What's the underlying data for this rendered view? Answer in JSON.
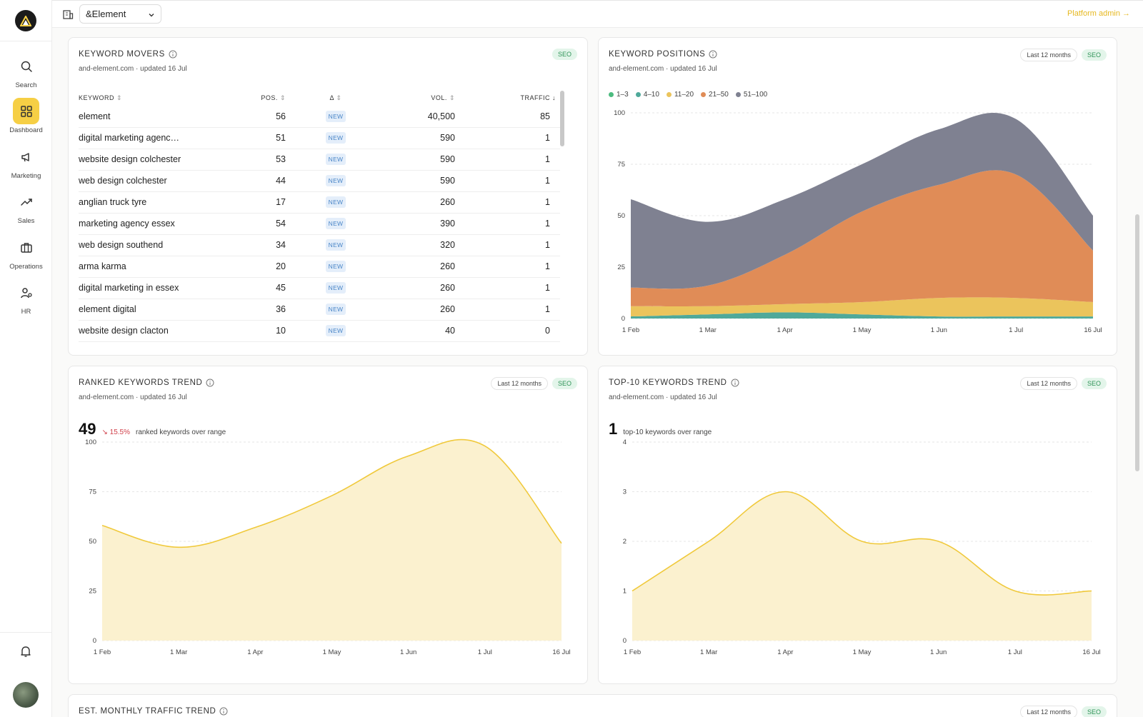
{
  "sidebar": {
    "items": [
      {
        "label": "Search",
        "icon": "search-icon"
      },
      {
        "label": "Dashboard",
        "icon": "dashboard-icon",
        "active": true
      },
      {
        "label": "Marketing",
        "icon": "megaphone-icon"
      },
      {
        "label": "Sales",
        "icon": "trend-up-icon"
      },
      {
        "label": "Operations",
        "icon": "briefcase-icon"
      },
      {
        "label": "HR",
        "icon": "people-icon"
      }
    ]
  },
  "topbar": {
    "org": "&Element",
    "platform_admin": "Platform admin →"
  },
  "colors": {
    "accent": "#f6cf45",
    "seo_badge": "#2f9458",
    "p1_3": "#4cbb7f",
    "p4_10": "#4fa99a",
    "p11_20": "#ebc45c",
    "p21_50": "#e08c57",
    "p51_100": "#7f8191",
    "trend_line": "#f0c93b"
  },
  "keyword_movers": {
    "title": "KEYWORD MOVERS",
    "subtitle": "and-element.com · updated 16 Jul",
    "badge": "SEO",
    "columns": [
      "KEYWORD",
      "POS.",
      "Δ",
      "VOL.",
      "TRAFFIC"
    ],
    "rows": [
      {
        "keyword": "element",
        "pos": "56",
        "delta": "NEW",
        "vol": "40,500",
        "traffic": "85"
      },
      {
        "keyword": "digital marketing agenc…",
        "pos": "51",
        "delta": "NEW",
        "vol": "590",
        "traffic": "1"
      },
      {
        "keyword": "website design colchester",
        "pos": "53",
        "delta": "NEW",
        "vol": "590",
        "traffic": "1"
      },
      {
        "keyword": "web design colchester",
        "pos": "44",
        "delta": "NEW",
        "vol": "590",
        "traffic": "1"
      },
      {
        "keyword": "anglian truck tyre",
        "pos": "17",
        "delta": "NEW",
        "vol": "260",
        "traffic": "1"
      },
      {
        "keyword": "marketing agency essex",
        "pos": "54",
        "delta": "NEW",
        "vol": "390",
        "traffic": "1"
      },
      {
        "keyword": "web design southend",
        "pos": "34",
        "delta": "NEW",
        "vol": "320",
        "traffic": "1"
      },
      {
        "keyword": "arma karma",
        "pos": "20",
        "delta": "NEW",
        "vol": "260",
        "traffic": "1"
      },
      {
        "keyword": "digital marketing in essex",
        "pos": "45",
        "delta": "NEW",
        "vol": "260",
        "traffic": "1"
      },
      {
        "keyword": "element digital",
        "pos": "36",
        "delta": "NEW",
        "vol": "260",
        "traffic": "1"
      },
      {
        "keyword": "website design clacton",
        "pos": "10",
        "delta": "NEW",
        "vol": "40",
        "traffic": "0"
      }
    ]
  },
  "keyword_positions": {
    "title": "KEYWORD POSITIONS",
    "subtitle": "and-element.com · updated 16 Jul",
    "range": "Last 12 months",
    "badge": "SEO"
  },
  "ranked_trend": {
    "title": "RANKED KEYWORDS TREND",
    "subtitle": "and-element.com · updated 16 Jul",
    "range": "Last 12 months",
    "badge": "SEO",
    "value": "49",
    "delta": "↘ 15.5%",
    "caption": "ranked keywords over range"
  },
  "top10_trend": {
    "title": "TOP-10 KEYWORDS TREND",
    "subtitle": "and-element.com · updated 16 Jul",
    "range": "Last 12 months",
    "badge": "SEO",
    "value": "1",
    "caption": "top-10 keywords over range"
  },
  "traffic_trend": {
    "title": "EST. MONTHLY TRAFFIC TREND",
    "range": "Last 12 months",
    "badge": "SEO"
  },
  "chart_data": [
    {
      "type": "area",
      "stacked": true,
      "title": "KEYWORD POSITIONS",
      "x": [
        "1 Feb",
        "1 Mar",
        "1 Apr",
        "1 May",
        "1 Jun",
        "1 Jul",
        "16 Jul"
      ],
      "ylim": [
        0,
        100
      ],
      "yticks": [
        0,
        25,
        50,
        75,
        100
      ],
      "legend": "top-left",
      "grid": true,
      "series": [
        {
          "name": "1–3",
          "values": [
            0,
            0,
            0,
            0,
            0,
            0,
            0
          ]
        },
        {
          "name": "4–10",
          "values": [
            1,
            2,
            3,
            2,
            1,
            1,
            1
          ]
        },
        {
          "name": "11–20",
          "values": [
            5,
            4,
            4,
            6,
            9,
            9,
            7
          ]
        },
        {
          "name": "21–50",
          "values": [
            9,
            10,
            24,
            44,
            55,
            60,
            25
          ]
        },
        {
          "name": "51–100",
          "values": [
            43,
            31,
            27,
            23,
            27,
            27,
            17
          ]
        }
      ]
    },
    {
      "type": "area",
      "title": "RANKED KEYWORDS TREND",
      "x": [
        "1 Feb",
        "1 Mar",
        "1 Apr",
        "1 May",
        "1 Jun",
        "1 Jul",
        "16 Jul"
      ],
      "ylim": [
        0,
        100
      ],
      "yticks": [
        0,
        25,
        50,
        75,
        100
      ],
      "grid": true,
      "series": [
        {
          "values": [
            58,
            47,
            57,
            73,
            93,
            98,
            49
          ]
        }
      ]
    },
    {
      "type": "area",
      "title": "TOP-10 KEYWORDS TREND",
      "x": [
        "1 Feb",
        "1 Mar",
        "1 Apr",
        "1 May",
        "1 Jun",
        "1 Jul",
        "16 Jul"
      ],
      "ylim": [
        0,
        4
      ],
      "yticks": [
        0,
        1,
        2,
        3,
        4
      ],
      "grid": true,
      "series": [
        {
          "values": [
            1,
            2,
            3,
            2,
            2,
            1,
            1
          ]
        }
      ]
    }
  ]
}
